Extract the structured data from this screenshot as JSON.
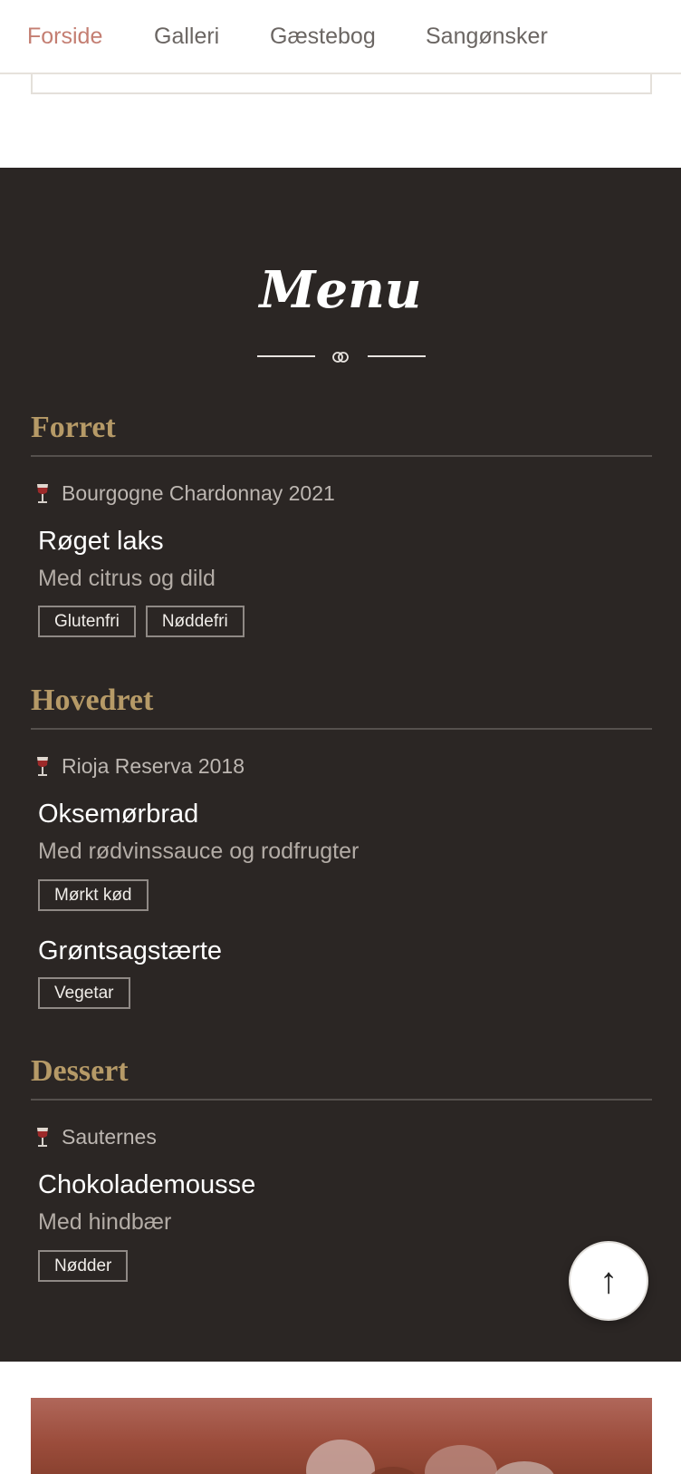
{
  "nav": {
    "items": [
      {
        "label": "Forside",
        "active": true
      },
      {
        "label": "Galleri",
        "active": false
      },
      {
        "label": "Gæstebog",
        "active": false
      },
      {
        "label": "Sangønsker",
        "active": false
      }
    ]
  },
  "menu": {
    "title": "Menu",
    "courses": [
      {
        "title": "Forret",
        "wine": "Bourgogne Chardonnay 2021",
        "dishes": [
          {
            "name": "Røget laks",
            "description": "Med citrus og dild",
            "tags": [
              "Glutenfri",
              "Nøddefri"
            ]
          }
        ]
      },
      {
        "title": "Hovedret",
        "wine": "Rioja Reserva 2018",
        "dishes": [
          {
            "name": "Oksemørbrad",
            "description": "Med rødvinssauce og rodfrugter",
            "tags": [
              "Mørkt kød"
            ]
          },
          {
            "name": "Grøntsagstærte",
            "description": "",
            "tags": [
              "Vegetar"
            ]
          }
        ]
      },
      {
        "title": "Dessert",
        "wine": "Sauternes",
        "dishes": [
          {
            "name": "Chokolademousse",
            "description": "Med hindbær",
            "tags": [
              "Nødder"
            ]
          }
        ]
      }
    ]
  },
  "scroll_top": {
    "label": "↑"
  },
  "colors": {
    "accent_pink": "#c47e72",
    "gold": "#b69a67",
    "dark_bg": "#2b2624"
  }
}
